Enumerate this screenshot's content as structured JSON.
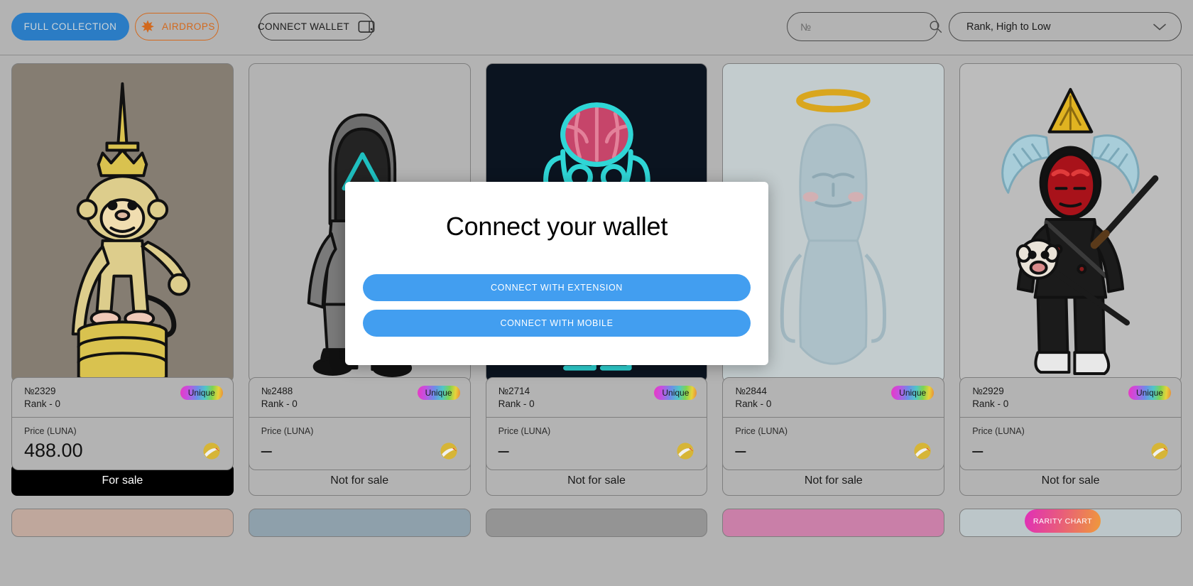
{
  "header": {
    "full_collection_label": "FULL COLLECTION",
    "airdrops_label": "AIRDROPS",
    "airdrops_icon": "star-burst-icon",
    "connect_wallet_label": "CONNECT WALLET",
    "wallet_icon": "wallet-icon",
    "search": {
      "placeholder": "№",
      "value": "",
      "icon": "search-icon"
    },
    "sort": {
      "selected": "Rank, High to Low",
      "icon": "chevron-down-icon"
    },
    "colors": {
      "full_collection_bg": "#2b7cc4",
      "airdrops_accent": "#d2691e",
      "page_bg": "#b3b3b3"
    }
  },
  "modal": {
    "title": "Connect your wallet",
    "extension_label": "CONNECT WITH EXTENSION",
    "mobile_label": "CONNECT WITH MOBILE",
    "button_color": "#429ef0"
  },
  "rarity_chart": {
    "label": "RARITY CHART"
  },
  "grid": {
    "price_label": "Price (LUNA)",
    "badge_label": "Unique",
    "coin_icon": "luna-coin-icon",
    "for_sale_label": "For sale",
    "not_for_sale_label": "Not for sale",
    "cards": [
      {
        "id": "№2329",
        "rank": "Rank - 0",
        "badge": "Unique",
        "price_label": "Price (LUNA)",
        "price": "488.00",
        "status": "For sale",
        "for_sale": true,
        "art": "king-monkey-sword",
        "art_bg": "#857d72"
      },
      {
        "id": "№2488",
        "rank": "Rank - 0",
        "badge": "Unique",
        "price_label": "Price (LUNA)",
        "price": "–",
        "status": "Not for sale",
        "for_sale": false,
        "art": "squid-game-triangle-guard",
        "art_bg": "#b3b3b3"
      },
      {
        "id": "№2714",
        "rank": "Rank - 0",
        "badge": "Unique",
        "price_label": "Price (LUNA)",
        "price": "–",
        "status": "Not for sale",
        "for_sale": false,
        "art": "neon-brain-skull",
        "art_bg": "#0b1420"
      },
      {
        "id": "№2844",
        "rank": "Rank - 0",
        "badge": "Unique",
        "price_label": "Price (LUNA)",
        "price": "–",
        "status": "Not for sale",
        "for_sale": false,
        "art": "ghost-angel-halo",
        "art_bg": "#c3ccce"
      },
      {
        "id": "№2929",
        "rank": "Rank - 0",
        "badge": "Unique",
        "price_label": "Price (LUNA)",
        "price": "–",
        "status": "Not for sale",
        "for_sale": false,
        "art": "red-demon-samurai",
        "art_bg": "#bcbcbc"
      }
    ],
    "next_row_art_bg": [
      "#bfa79c",
      "#8ea0ab",
      "#949494",
      "#c97fa8",
      "#bcc6c9"
    ]
  }
}
